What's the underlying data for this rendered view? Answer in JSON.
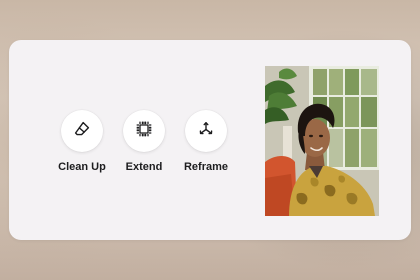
{
  "tools": [
    {
      "label": "Clean Up",
      "icon": "eraser-icon"
    },
    {
      "label": "Extend",
      "icon": "extend-frame-icon"
    },
    {
      "label": "Reframe",
      "icon": "reframe-axes-icon"
    }
  ],
  "colors": {
    "card_background": "#f4f2f4",
    "button_background": "#ffffff",
    "label_text": "#1d1d1f"
  }
}
